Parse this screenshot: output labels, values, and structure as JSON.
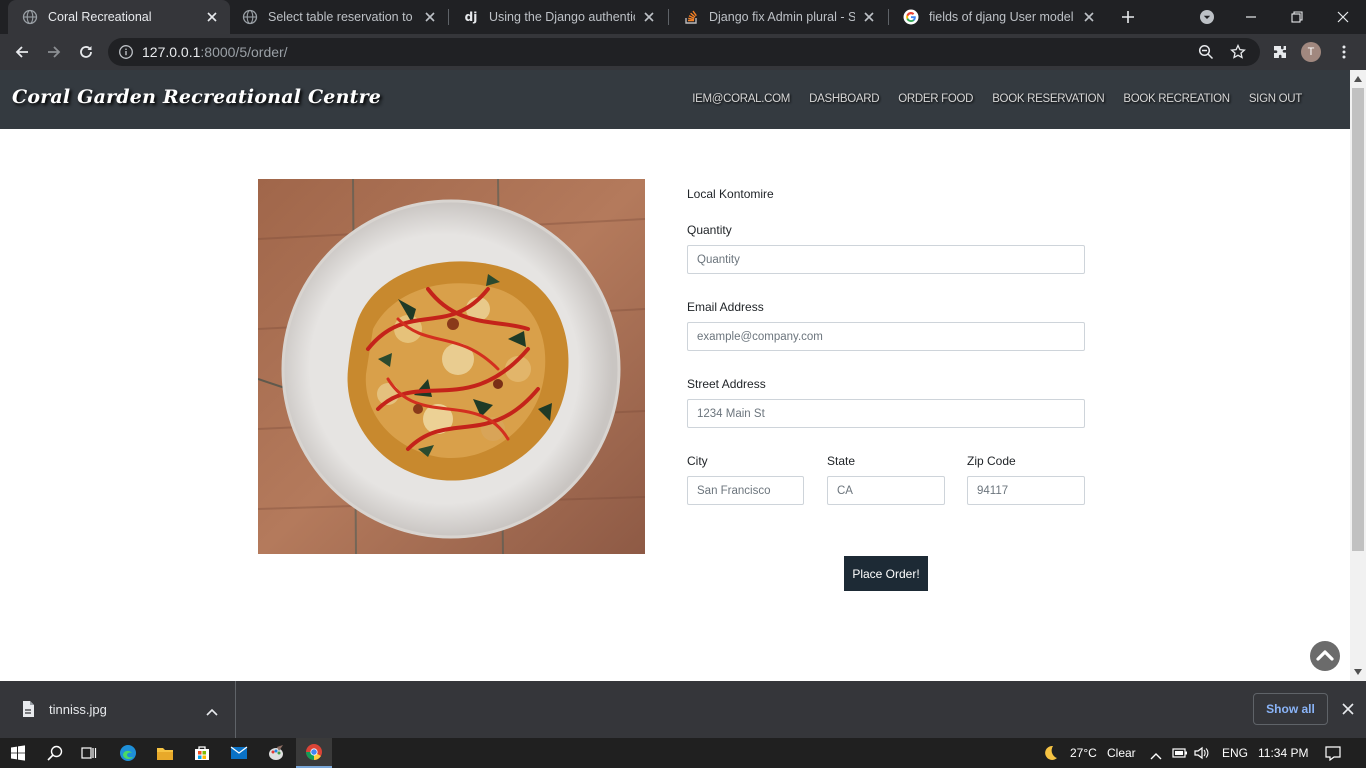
{
  "browser": {
    "tabs": [
      {
        "title": "Coral Recreational",
        "active": true,
        "icon": "globe-icon"
      },
      {
        "title": "Select table reservation to ch",
        "active": false,
        "icon": "globe-icon"
      },
      {
        "title": "Using the Django authenticat",
        "active": false,
        "icon": "django-icon"
      },
      {
        "title": "Django fix Admin plural - Sta",
        "active": false,
        "icon": "stackoverflow-icon"
      },
      {
        "title": "fields of djang User model - (",
        "active": false,
        "icon": "google-icon"
      }
    ],
    "url_host": "127.0.0.1",
    "url_rest": ":8000/5/order/",
    "profile_initial": "T"
  },
  "site": {
    "brand": "Coral Garden Recreational Centre",
    "nav": [
      "IEM@CORAL.COM",
      "DASHBOARD",
      "ORDER FOOD",
      "BOOK RESERVATION",
      "BOOK RECREATION",
      "SIGN OUT"
    ]
  },
  "order": {
    "item_name": "Local Kontomire",
    "quantity_label": "Quantity",
    "quantity_placeholder": "Quantity",
    "email_label": "Email Address",
    "email_placeholder": "example@company.com",
    "street_label": "Street Address",
    "street_placeholder": "1234 Main St",
    "city_label": "City",
    "city_placeholder": "San Francisco",
    "state_label": "State",
    "state_placeholder": "CA",
    "zip_label": "Zip Code",
    "zip_placeholder": "94117",
    "submit_label": "Place Order!"
  },
  "downloads": {
    "file_name": "tinniss.jpg",
    "show_all": "Show all"
  },
  "taskbar": {
    "temperature": "27°C",
    "weather": "Clear",
    "language": "ENG",
    "time": "11:34 PM"
  }
}
